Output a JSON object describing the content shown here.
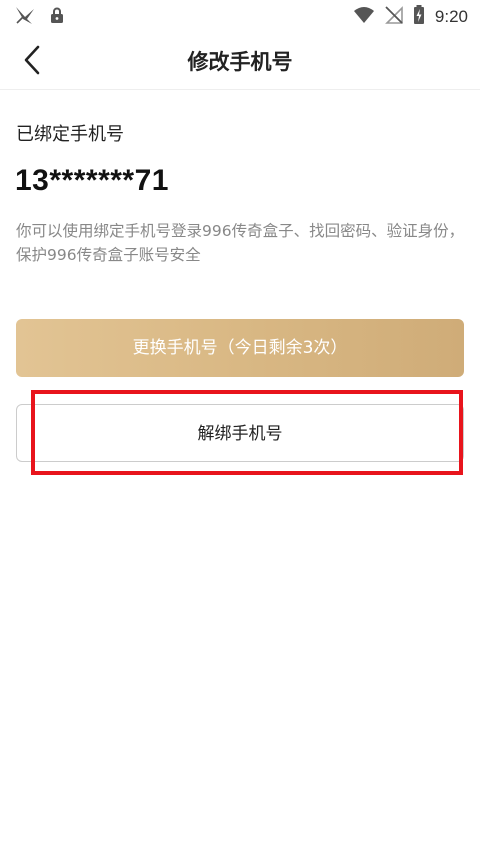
{
  "status_bar": {
    "time": "9:20",
    "icons_left": [
      "bird-notification-icon",
      "lock-icon"
    ],
    "icons_right": [
      "wifi-icon",
      "no-sim-icon",
      "battery-charging-icon"
    ]
  },
  "nav": {
    "title": "修改手机号",
    "back_icon": "chevron-left-icon"
  },
  "content": {
    "section_label": "已绑定手机号",
    "phone_number": "13*******71",
    "description": "你可以使用绑定手机号登录996传奇盒子、找回密码、验证身份，保护996传奇盒子账号安全"
  },
  "buttons": {
    "change_label": "更换手机号（今日剩余3次）",
    "unbind_label": "解绑手机号"
  },
  "colors": {
    "accent_gold": "#d9b884",
    "highlight_red": "#e8141c"
  }
}
